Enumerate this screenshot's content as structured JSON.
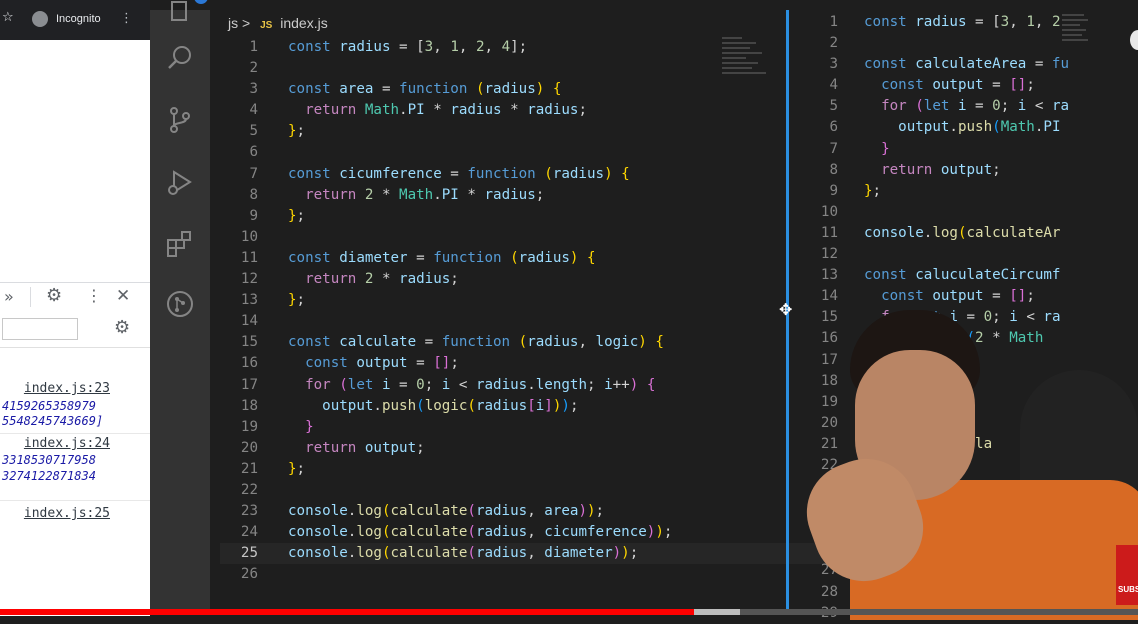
{
  "browser": {
    "tab_label": "Incognito",
    "console": [
      {
        "source": "index.js:23",
        "values": [
          "4159265358979",
          "5548245743669]"
        ]
      },
      {
        "source": "index.js:24",
        "values": [
          "3318530717958",
          "3274122871834"
        ]
      },
      {
        "source": "index.js:25",
        "values": []
      }
    ]
  },
  "editor": {
    "breadcrumb_folder": "js",
    "breadcrumb_sep": ">",
    "file_badge": "JS",
    "file_name": "index.js",
    "left_lines": [
      [
        {
          "t": "const ",
          "c": "kw"
        },
        {
          "t": "radius",
          "c": "var"
        },
        {
          "t": " = [",
          "c": "pl"
        },
        {
          "t": "3",
          "c": "num"
        },
        {
          "t": ", ",
          "c": "pl"
        },
        {
          "t": "1",
          "c": "num"
        },
        {
          "t": ", ",
          "c": "pl"
        },
        {
          "t": "2",
          "c": "num"
        },
        {
          "t": ", ",
          "c": "pl"
        },
        {
          "t": "4",
          "c": "num"
        },
        {
          "t": "];",
          "c": "pl"
        }
      ],
      [],
      [
        {
          "t": "const ",
          "c": "kw"
        },
        {
          "t": "area",
          "c": "var"
        },
        {
          "t": " = ",
          "c": "pl"
        },
        {
          "t": "function",
          "c": "kw"
        },
        {
          "t": " ",
          "c": "pl"
        },
        {
          "t": "(",
          "c": "br1"
        },
        {
          "t": "radius",
          "c": "var"
        },
        {
          "t": ") ",
          "c": "br1"
        },
        {
          "t": "{",
          "c": "br1"
        }
      ],
      [
        {
          "t": "  return ",
          "c": "kw2"
        },
        {
          "t": "Math",
          "c": "cls"
        },
        {
          "t": ".",
          "c": "pl"
        },
        {
          "t": "PI",
          "c": "var"
        },
        {
          "t": " * ",
          "c": "pl"
        },
        {
          "t": "radius",
          "c": "var"
        },
        {
          "t": " * ",
          "c": "pl"
        },
        {
          "t": "radius",
          "c": "var"
        },
        {
          "t": ";",
          "c": "pl"
        }
      ],
      [
        {
          "t": "}",
          "c": "br1"
        },
        {
          "t": ";",
          "c": "pl"
        }
      ],
      [],
      [
        {
          "t": "const ",
          "c": "kw"
        },
        {
          "t": "cicumference",
          "c": "var"
        },
        {
          "t": " = ",
          "c": "pl"
        },
        {
          "t": "function",
          "c": "kw"
        },
        {
          "t": " ",
          "c": "pl"
        },
        {
          "t": "(",
          "c": "br1"
        },
        {
          "t": "radius",
          "c": "var"
        },
        {
          "t": ") ",
          "c": "br1"
        },
        {
          "t": "{",
          "c": "br1"
        }
      ],
      [
        {
          "t": "  return ",
          "c": "kw2"
        },
        {
          "t": "2",
          "c": "num"
        },
        {
          "t": " * ",
          "c": "pl"
        },
        {
          "t": "Math",
          "c": "cls"
        },
        {
          "t": ".",
          "c": "pl"
        },
        {
          "t": "PI",
          "c": "var"
        },
        {
          "t": " * ",
          "c": "pl"
        },
        {
          "t": "radius",
          "c": "var"
        },
        {
          "t": ";",
          "c": "pl"
        }
      ],
      [
        {
          "t": "}",
          "c": "br1"
        },
        {
          "t": ";",
          "c": "pl"
        }
      ],
      [],
      [
        {
          "t": "const ",
          "c": "kw"
        },
        {
          "t": "diameter",
          "c": "var"
        },
        {
          "t": " = ",
          "c": "pl"
        },
        {
          "t": "function",
          "c": "kw"
        },
        {
          "t": " ",
          "c": "pl"
        },
        {
          "t": "(",
          "c": "br1"
        },
        {
          "t": "radius",
          "c": "var"
        },
        {
          "t": ") ",
          "c": "br1"
        },
        {
          "t": "{",
          "c": "br1"
        }
      ],
      [
        {
          "t": "  return ",
          "c": "kw2"
        },
        {
          "t": "2",
          "c": "num"
        },
        {
          "t": " * ",
          "c": "pl"
        },
        {
          "t": "radius",
          "c": "var"
        },
        {
          "t": ";",
          "c": "pl"
        }
      ],
      [
        {
          "t": "}",
          "c": "br1"
        },
        {
          "t": ";",
          "c": "pl"
        }
      ],
      [],
      [
        {
          "t": "const ",
          "c": "kw"
        },
        {
          "t": "calculate",
          "c": "var"
        },
        {
          "t": " = ",
          "c": "pl"
        },
        {
          "t": "function",
          "c": "kw"
        },
        {
          "t": " ",
          "c": "pl"
        },
        {
          "t": "(",
          "c": "br1"
        },
        {
          "t": "radius",
          "c": "var"
        },
        {
          "t": ", ",
          "c": "pl"
        },
        {
          "t": "logic",
          "c": "var"
        },
        {
          "t": ") ",
          "c": "br1"
        },
        {
          "t": "{",
          "c": "br1"
        }
      ],
      [
        {
          "t": "  const ",
          "c": "kw"
        },
        {
          "t": "output",
          "c": "var"
        },
        {
          "t": " = ",
          "c": "pl"
        },
        {
          "t": "[]",
          "c": "br2"
        },
        {
          "t": ";",
          "c": "pl"
        }
      ],
      [
        {
          "t": "  for ",
          "c": "kw2"
        },
        {
          "t": "(",
          "c": "br2"
        },
        {
          "t": "let ",
          "c": "kw"
        },
        {
          "t": "i",
          "c": "var"
        },
        {
          "t": " = ",
          "c": "pl"
        },
        {
          "t": "0",
          "c": "num"
        },
        {
          "t": "; ",
          "c": "pl"
        },
        {
          "t": "i",
          "c": "var"
        },
        {
          "t": " < ",
          "c": "pl"
        },
        {
          "t": "radius",
          "c": "var"
        },
        {
          "t": ".",
          "c": "pl"
        },
        {
          "t": "length",
          "c": "var"
        },
        {
          "t": "; ",
          "c": "pl"
        },
        {
          "t": "i",
          "c": "var"
        },
        {
          "t": "++",
          "c": "pl"
        },
        {
          "t": ") {",
          "c": "br2"
        }
      ],
      [
        {
          "t": "    output",
          "c": "var"
        },
        {
          "t": ".",
          "c": "pl"
        },
        {
          "t": "push",
          "c": "fn"
        },
        {
          "t": "(",
          "c": "br3"
        },
        {
          "t": "logic",
          "c": "fn"
        },
        {
          "t": "(",
          "c": "br1"
        },
        {
          "t": "radius",
          "c": "var"
        },
        {
          "t": "[",
          "c": "br2"
        },
        {
          "t": "i",
          "c": "var"
        },
        {
          "t": "]",
          "c": "br2"
        },
        {
          "t": ")",
          "c": "br1"
        },
        {
          "t": ")",
          "c": "br3"
        },
        {
          "t": ";",
          "c": "pl"
        }
      ],
      [
        {
          "t": "  }",
          "c": "br2"
        }
      ],
      [
        {
          "t": "  return ",
          "c": "kw2"
        },
        {
          "t": "output",
          "c": "var"
        },
        {
          "t": ";",
          "c": "pl"
        }
      ],
      [
        {
          "t": "}",
          "c": "br1"
        },
        {
          "t": ";",
          "c": "pl"
        }
      ],
      [],
      [
        {
          "t": "console",
          "c": "var"
        },
        {
          "t": ".",
          "c": "pl"
        },
        {
          "t": "log",
          "c": "fn"
        },
        {
          "t": "(",
          "c": "br1"
        },
        {
          "t": "calculate",
          "c": "fn"
        },
        {
          "t": "(",
          "c": "br2"
        },
        {
          "t": "radius",
          "c": "var"
        },
        {
          "t": ", ",
          "c": "pl"
        },
        {
          "t": "area",
          "c": "var"
        },
        {
          "t": ")",
          "c": "br2"
        },
        {
          "t": ")",
          "c": "br1"
        },
        {
          "t": ";",
          "c": "pl"
        }
      ],
      [
        {
          "t": "console",
          "c": "var"
        },
        {
          "t": ".",
          "c": "pl"
        },
        {
          "t": "log",
          "c": "fn"
        },
        {
          "t": "(",
          "c": "br1"
        },
        {
          "t": "calculate",
          "c": "fn"
        },
        {
          "t": "(",
          "c": "br2"
        },
        {
          "t": "radius",
          "c": "var"
        },
        {
          "t": ", ",
          "c": "pl"
        },
        {
          "t": "cicumference",
          "c": "var"
        },
        {
          "t": ")",
          "c": "br2"
        },
        {
          "t": ")",
          "c": "br1"
        },
        {
          "t": ";",
          "c": "pl"
        }
      ],
      [
        {
          "t": "console",
          "c": "var"
        },
        {
          "t": ".",
          "c": "pl"
        },
        {
          "t": "log",
          "c": "fn"
        },
        {
          "t": "(",
          "c": "br1"
        },
        {
          "t": "calculate",
          "c": "fn"
        },
        {
          "t": "(",
          "c": "br2"
        },
        {
          "t": "radius",
          "c": "var"
        },
        {
          "t": ", ",
          "c": "pl"
        },
        {
          "t": "diameter",
          "c": "var"
        },
        {
          "t": ")",
          "c": "br2"
        },
        {
          "t": ")",
          "c": "br1"
        },
        {
          "t": ";",
          "c": "pl"
        }
      ],
      []
    ],
    "right_lines": [
      [
        {
          "t": "const ",
          "c": "kw"
        },
        {
          "t": "radius",
          "c": "var"
        },
        {
          "t": " = [",
          "c": "pl"
        },
        {
          "t": "3",
          "c": "num"
        },
        {
          "t": ", ",
          "c": "pl"
        },
        {
          "t": "1",
          "c": "num"
        },
        {
          "t": ", ",
          "c": "pl"
        },
        {
          "t": "2",
          "c": "num"
        }
      ],
      [],
      [
        {
          "t": "const ",
          "c": "kw"
        },
        {
          "t": "calculateArea",
          "c": "var"
        },
        {
          "t": " = ",
          "c": "pl"
        },
        {
          "t": "fu",
          "c": "kw"
        }
      ],
      [
        {
          "t": "  const ",
          "c": "kw"
        },
        {
          "t": "output",
          "c": "var"
        },
        {
          "t": " = ",
          "c": "pl"
        },
        {
          "t": "[]",
          "c": "br2"
        },
        {
          "t": ";",
          "c": "pl"
        }
      ],
      [
        {
          "t": "  for ",
          "c": "kw2"
        },
        {
          "t": "(",
          "c": "br2"
        },
        {
          "t": "let ",
          "c": "kw"
        },
        {
          "t": "i",
          "c": "var"
        },
        {
          "t": " = ",
          "c": "pl"
        },
        {
          "t": "0",
          "c": "num"
        },
        {
          "t": "; ",
          "c": "pl"
        },
        {
          "t": "i",
          "c": "var"
        },
        {
          "t": " < ",
          "c": "pl"
        },
        {
          "t": "ra",
          "c": "var"
        }
      ],
      [
        {
          "t": "    output",
          "c": "var"
        },
        {
          "t": ".",
          "c": "pl"
        },
        {
          "t": "push",
          "c": "fn"
        },
        {
          "t": "(",
          "c": "br3"
        },
        {
          "t": "Math",
          "c": "cls"
        },
        {
          "t": ".",
          "c": "pl"
        },
        {
          "t": "PI",
          "c": "var"
        }
      ],
      [
        {
          "t": "  }",
          "c": "br2"
        }
      ],
      [
        {
          "t": "  return ",
          "c": "kw2"
        },
        {
          "t": "output",
          "c": "var"
        },
        {
          "t": ";",
          "c": "pl"
        }
      ],
      [
        {
          "t": "}",
          "c": "br1"
        },
        {
          "t": ";",
          "c": "pl"
        }
      ],
      [],
      [
        {
          "t": "console",
          "c": "var"
        },
        {
          "t": ".",
          "c": "pl"
        },
        {
          "t": "log",
          "c": "fn"
        },
        {
          "t": "(",
          "c": "br1"
        },
        {
          "t": "calculateAr",
          "c": "fn"
        }
      ],
      [],
      [
        {
          "t": "const ",
          "c": "kw"
        },
        {
          "t": "caluculateCircumf",
          "c": "var"
        }
      ],
      [
        {
          "t": "  const ",
          "c": "kw"
        },
        {
          "t": "output",
          "c": "var"
        },
        {
          "t": " = ",
          "c": "pl"
        },
        {
          "t": "[]",
          "c": "br2"
        },
        {
          "t": ";",
          "c": "pl"
        }
      ],
      [
        {
          "t": "  f",
          "c": "kw2"
        },
        {
          "t": "  (let ",
          "c": "kw"
        },
        {
          "t": "i",
          "c": "var"
        },
        {
          "t": " = ",
          "c": "pl"
        },
        {
          "t": "0",
          "c": "num"
        },
        {
          "t": "; ",
          "c": "pl"
        },
        {
          "t": "i",
          "c": "var"
        },
        {
          "t": " < ",
          "c": "pl"
        },
        {
          "t": "ra",
          "c": "var"
        }
      ],
      [
        {
          "t": "         ush",
          "c": "fn"
        },
        {
          "t": "(",
          "c": "br3"
        },
        {
          "t": "2",
          "c": "num"
        },
        {
          "t": " * ",
          "c": "pl"
        },
        {
          "t": "Math",
          "c": "cls"
        }
      ],
      [],
      [
        {
          "t": "          t",
          "c": "var"
        },
        {
          "t": ";",
          "c": "pl"
        }
      ],
      [],
      [],
      [
        {
          "t": "          lcula",
          "c": "fn"
        }
      ],
      [],
      [],
      [],
      [],
      [],
      [],
      [],
      []
    ]
  },
  "video": {
    "subscribe_label": "SUBS",
    "text_cursor": "T",
    "progress_fraction": 0.61,
    "buffer_fraction": 0.65,
    "progress_color": "#ff0000"
  }
}
